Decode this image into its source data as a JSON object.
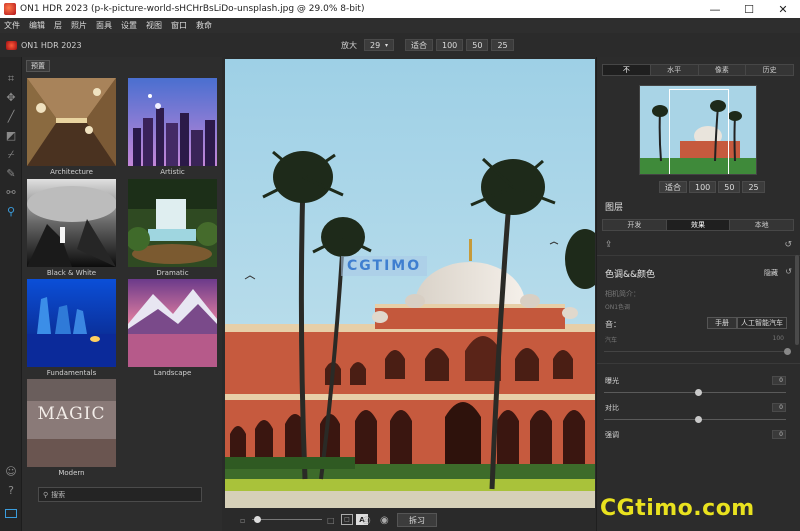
{
  "window": {
    "title": "ON1 HDR 2023 (p-k-picture-world-sHCHrBsLiDo-unsplash.jpg @ 29.0% 8-bit)",
    "minimize": "—",
    "maximize": "☐",
    "close": "✕"
  },
  "menu": [
    "文件",
    "编辑",
    "层",
    "照片",
    "面具",
    "设置",
    "视图",
    "窗口",
    "救命"
  ],
  "brand": "ON1 HDR 2023",
  "zoom": {
    "label": "放大",
    "value": "29",
    "fit": "适合",
    "options": [
      "100",
      "50",
      "25"
    ]
  },
  "tools": [
    "crop-icon",
    "move-icon",
    "brush-icon",
    "gradient-icon",
    "eraser-icon",
    "retouch-icon",
    "clone-icon",
    "zoom-icon"
  ],
  "presets": {
    "tab": "预置",
    "items": [
      {
        "label": "Architecture",
        "icon": "architecture-thumb"
      },
      {
        "label": "Artistic",
        "icon": "artistic-thumb"
      },
      {
        "label": "Black & White",
        "icon": "bw-thumb"
      },
      {
        "label": "Dramatic",
        "icon": "dramatic-thumb"
      },
      {
        "label": "Fundamentals",
        "icon": "fundamentals-thumb"
      },
      {
        "label": "Landscape",
        "icon": "landscape-thumb"
      },
      {
        "label": "Modern",
        "icon": "modern-thumb",
        "text": "MAGIC"
      }
    ],
    "search_placeholder": "搜索"
  },
  "canvas": {
    "watermark": "CGTIMO",
    "export_button": "拆习"
  },
  "right": {
    "view_tabs": [
      "不",
      "水平",
      "像素",
      "历史"
    ],
    "nav_fit": "适合",
    "nav_zoom": [
      "100",
      "50",
      "25"
    ],
    "layers_title": "图层",
    "layer_tabs": [
      "开发",
      "效果",
      "本地"
    ],
    "section_title": "色调&&颜色",
    "section_right": "隐藏",
    "camera_profile": "相机简介：",
    "camera_profile_value": "ON1色调",
    "tone_label": "音：",
    "tone_manual": "手册",
    "tone_ai": "人工智能汽车",
    "auto_label": "汽车",
    "auto_val": "100",
    "sliders": [
      {
        "label": "曝光",
        "value": "0"
      },
      {
        "label": "对比",
        "value": "0"
      },
      {
        "label": "强调",
        "value": "0"
      }
    ]
  },
  "site_watermark": "CGtimo.com"
}
